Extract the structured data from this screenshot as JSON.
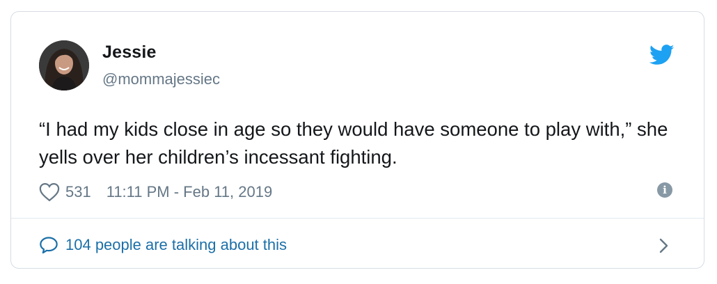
{
  "tweet": {
    "author_name": "Jessie",
    "author_handle": "@mommajessiec",
    "text": "“I had my kids close in age so they would have someone to play with,” she yells over her children’s incessant fighting.",
    "like_count": "531",
    "timestamp": "11:11 PM - Feb 11, 2019",
    "talking_text": "104 people are talking about this"
  },
  "icons": {
    "brand": "twitter-bird-icon",
    "like": "heart-icon",
    "info": "info-icon",
    "reply": "speech-bubble-icon",
    "chevron": "chevron-right-icon"
  },
  "colors": {
    "twitter_blue": "#1da1f2",
    "link_blue": "#1b6fa8",
    "secondary_text": "#657786",
    "primary_text": "#14171a",
    "border": "#d6dde3"
  }
}
